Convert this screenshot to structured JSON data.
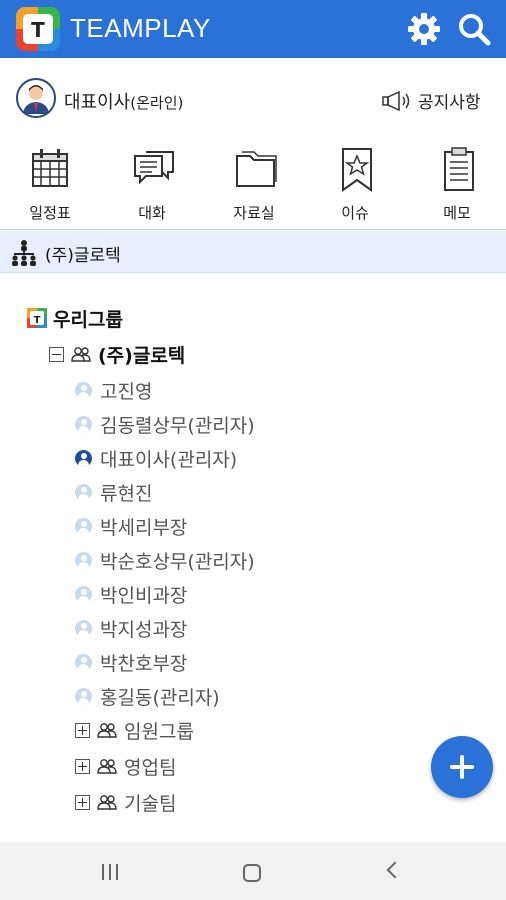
{
  "header": {
    "app_title": "TEAMPLAY",
    "logo_letter": "T",
    "icons": [
      "gear-icon",
      "search-icon"
    ],
    "accent_color": "#2a72d8"
  },
  "user": {
    "name": "대표이사",
    "status": "(온라인)",
    "notice_label": "공지사항"
  },
  "menu": {
    "items": [
      {
        "label": "일정표",
        "icon": "calendar-icon"
      },
      {
        "label": "대화",
        "icon": "chat-icon"
      },
      {
        "label": "자료실",
        "icon": "folder-icon"
      },
      {
        "label": "이슈",
        "icon": "bookmark-star-icon"
      },
      {
        "label": "메모",
        "icon": "clipboard-icon"
      }
    ]
  },
  "org_bar": {
    "label": "(주)글로텍",
    "icon": "org-chart-icon"
  },
  "tree": {
    "root_label": "우리그룹",
    "company_label": "(주)글로텍",
    "members": [
      "고진영",
      "김동렬상무(관리자)",
      "대표이사(관리자)",
      "류현진",
      "박세리부장",
      "박순호상무(관리자)",
      "박인비과장",
      "박지성과장",
      "박찬호부장",
      "홍길동(관리자)"
    ],
    "active_member_index": 2,
    "groups": [
      "임원그룹",
      "영업팀",
      "기술팀"
    ]
  },
  "fab": {
    "icon": "plus-icon"
  },
  "system_nav": {
    "icons": [
      "recent-apps-icon",
      "home-icon",
      "back-icon"
    ]
  }
}
